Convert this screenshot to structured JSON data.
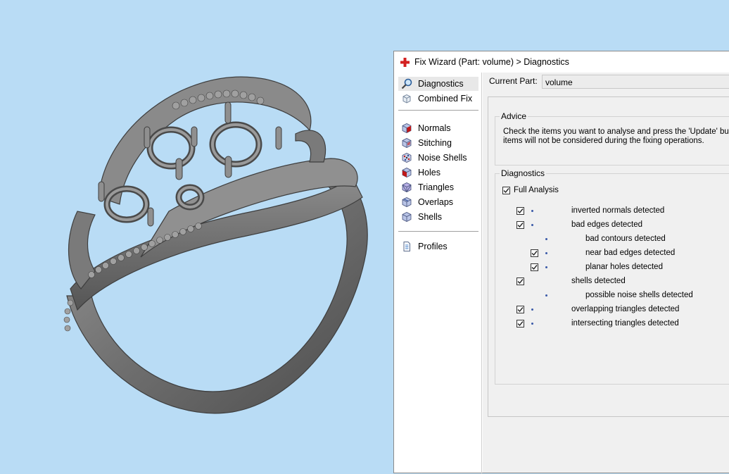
{
  "window": {
    "title": "Fix Wizard (Part: volume) > Diagnostics",
    "title_icon": "red-cross-icon"
  },
  "nav": {
    "group1": [
      {
        "label": "Diagnostics",
        "icon": "magnifier-icon",
        "selected": true
      },
      {
        "label": "Combined Fix",
        "icon": "cube-outline-icon",
        "selected": false
      }
    ],
    "group2": [
      {
        "label": "Normals",
        "icon": "normals-cube-icon"
      },
      {
        "label": "Stitching",
        "icon": "stitching-cube-icon"
      },
      {
        "label": "Noise Shells",
        "icon": "noise-shells-icon"
      },
      {
        "label": "Holes",
        "icon": "holes-cube-icon"
      },
      {
        "label": "Triangles",
        "icon": "triangles-cube-icon"
      },
      {
        "label": "Overlaps",
        "icon": "overlaps-cube-icon"
      },
      {
        "label": "Shells",
        "icon": "shells-cube-icon"
      }
    ],
    "group3": [
      {
        "label": "Profiles",
        "icon": "document-icon"
      }
    ]
  },
  "current_part": {
    "label": "Current Part:",
    "value": "volume"
  },
  "advice": {
    "title": "Advice",
    "line1": "Check the items you want to analyse and press the 'Update' bu",
    "line2": "items will not be considered during the fixing operations."
  },
  "diagnostics": {
    "title": "Diagnostics",
    "full_analysis_label": "Full Analysis",
    "full_analysis_checked": true,
    "items": [
      {
        "label": "inverted normals detected",
        "checked": true,
        "indent": 0
      },
      {
        "label": "bad edges detected",
        "checked": true,
        "indent": 0
      },
      {
        "label": "bad contours detected",
        "checked": false,
        "indent": 1
      },
      {
        "label": "near bad edges detected",
        "checked": true,
        "indent": 1
      },
      {
        "label": "planar holes detected",
        "checked": true,
        "indent": 1
      },
      {
        "label": "shells detected",
        "checked": true,
        "indent": 0
      },
      {
        "label": "possible noise shells detected",
        "checked": false,
        "indent": 1
      },
      {
        "label": "overlapping triangles detected",
        "checked": true,
        "indent": 0
      },
      {
        "label": "intersecting triangles detected",
        "checked": true,
        "indent": 0
      }
    ]
  },
  "colors": {
    "viewport_background": "#b9dcf5",
    "model_gray": "#7d7d7d",
    "bullet_blue": "#3a5aa8"
  }
}
